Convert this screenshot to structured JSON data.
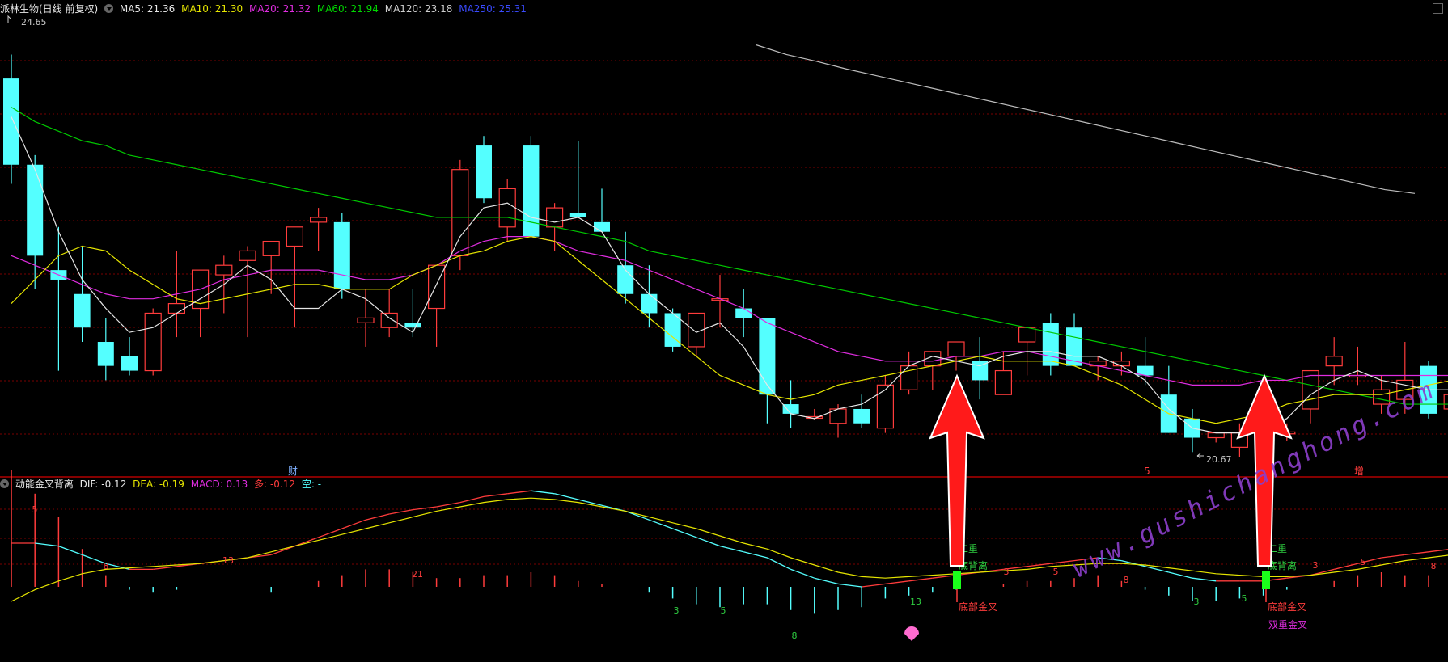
{
  "main_header": {
    "title": "派林生物(日线 前复权)",
    "ma5": "MA5: 21.36",
    "ma10": "MA10: 21.30",
    "ma20": "MA20: 21.32",
    "ma60": "MA60: 21.94",
    "ma120": "MA120: 23.18",
    "ma250": "MA250: 25.31"
  },
  "sub_header": {
    "title": "动能金叉背离",
    "dif": "DIF: -0.12",
    "dea": "DEA: -0.19",
    "macd": "MACD: 0.13",
    "duo": "多: -0.12",
    "kong": "空: -"
  },
  "colors": {
    "up": "#ff3c3c",
    "down": "#54ffff",
    "ma5": "#e6e6e6",
    "ma10": "#e6e600",
    "ma20": "#e02de0",
    "ma60": "#00c800",
    "ma120": "#bdbdbd",
    "ma250": "#2b3cff",
    "arrow": "#ff1a1a",
    "watermark": "#8a3ec8"
  },
  "chart_data": [
    {
      "type": "candlestick",
      "price_range": [
        20.3,
        25.0
      ],
      "high_label": "24.65",
      "low_label": "20.67",
      "candles": [
        [
          24.4,
          24.65,
          23.3,
          23.5
        ],
        [
          23.5,
          23.6,
          22.2,
          22.55
        ],
        [
          22.4,
          22.85,
          21.35,
          22.3
        ],
        [
          22.15,
          22.65,
          21.65,
          21.8
        ],
        [
          21.65,
          21.9,
          21.25,
          21.4
        ],
        [
          21.5,
          21.7,
          21.3,
          21.35
        ],
        [
          21.35,
          22.0,
          21.3,
          21.95
        ],
        [
          21.95,
          22.6,
          21.7,
          22.05
        ],
        [
          22.0,
          22.4,
          21.7,
          22.4
        ],
        [
          22.35,
          22.55,
          21.95,
          22.45
        ],
        [
          22.5,
          22.65,
          21.7,
          22.6
        ],
        [
          22.55,
          22.65,
          22.15,
          22.7
        ],
        [
          22.65,
          22.8,
          21.8,
          22.85
        ],
        [
          22.9,
          23.05,
          22.6,
          22.95
        ],
        [
          22.9,
          23.0,
          22.1,
          22.2
        ],
        [
          21.85,
          22.2,
          21.6,
          21.9
        ],
        [
          21.8,
          22.2,
          21.7,
          21.95
        ],
        [
          21.85,
          22.2,
          21.7,
          21.8
        ],
        [
          22.0,
          22.45,
          21.6,
          22.45
        ],
        [
          22.55,
          23.55,
          22.4,
          23.45
        ],
        [
          23.7,
          23.8,
          23.1,
          23.15
        ],
        [
          22.85,
          23.35,
          22.7,
          23.25
        ],
        [
          23.7,
          23.8,
          22.75,
          22.75
        ],
        [
          22.85,
          23.1,
          22.6,
          23.05
        ],
        [
          23.0,
          23.75,
          22.95,
          22.95
        ],
        [
          22.9,
          23.25,
          22.9,
          22.8
        ],
        [
          22.45,
          22.8,
          22.05,
          22.15
        ],
        [
          22.15,
          22.45,
          21.8,
          21.95
        ],
        [
          21.95,
          22.0,
          21.55,
          21.6
        ],
        [
          21.6,
          21.95,
          21.5,
          21.95
        ],
        [
          22.1,
          22.35,
          21.8,
          22.1
        ],
        [
          22.0,
          22.2,
          21.7,
          21.9
        ],
        [
          21.9,
          21.9,
          20.8,
          21.1
        ],
        [
          21.0,
          21.25,
          20.75,
          20.9
        ],
        [
          20.87,
          20.95,
          20.84,
          20.87
        ],
        [
          20.8,
          21.0,
          20.65,
          20.95
        ],
        [
          20.95,
          21.1,
          20.75,
          20.8
        ],
        [
          20.75,
          21.3,
          20.7,
          21.2
        ],
        [
          21.15,
          21.55,
          21.1,
          21.4
        ],
        [
          21.4,
          21.55,
          21.15,
          21.55
        ],
        [
          21.5,
          21.6,
          21.35,
          21.65
        ],
        [
          21.45,
          21.7,
          21.05,
          21.25
        ],
        [
          21.1,
          21.55,
          21.1,
          21.35
        ],
        [
          21.65,
          21.8,
          21.3,
          21.8
        ],
        [
          21.85,
          21.95,
          21.3,
          21.4
        ],
        [
          21.8,
          21.95,
          21.5,
          21.4
        ],
        [
          21.4,
          21.5,
          21.25,
          21.45
        ],
        [
          21.4,
          21.55,
          21.3,
          21.45
        ],
        [
          21.4,
          21.7,
          21.2,
          21.3
        ],
        [
          21.1,
          21.4,
          20.7,
          20.7
        ],
        [
          20.85,
          20.95,
          20.5,
          20.65
        ],
        [
          20.65,
          20.7,
          20.6,
          20.7
        ],
        [
          20.55,
          20.8,
          20.45,
          20.7
        ],
        [
          20.65,
          20.8,
          20.62,
          20.7
        ],
        [
          20.69,
          20.8,
          20.62,
          20.71
        ],
        [
          20.95,
          21.35,
          20.8,
          21.35
        ],
        [
          21.4,
          21.7,
          21.2,
          21.5
        ],
        [
          21.3,
          21.6,
          21.2,
          21.3
        ],
        [
          21.0,
          21.3,
          20.9,
          21.15
        ],
        [
          21.05,
          21.65,
          20.9,
          21.25
        ],
        [
          21.4,
          21.45,
          20.85,
          20.9
        ],
        [
          20.95,
          21.85,
          20.8,
          21.1
        ],
        [
          21.05,
          21.35,
          20.8,
          21.3
        ]
      ],
      "ma5": [
        24.0,
        23.45,
        22.8,
        22.3,
        22.0,
        21.75,
        21.8,
        21.95,
        22.1,
        22.25,
        22.45,
        22.3,
        22.0,
        22.0,
        22.2,
        22.1,
        21.9,
        21.75,
        22.25,
        22.75,
        23.05,
        23.1,
        22.95,
        22.9,
        22.95,
        22.8,
        22.4,
        22.15,
        21.95,
        21.75,
        21.85,
        21.6,
        21.2,
        20.9,
        20.85,
        20.95,
        21.0,
        21.15,
        21.4,
        21.5,
        21.45,
        21.4,
        21.5,
        21.55,
        21.55,
        21.5,
        21.5,
        21.4,
        21.25,
        20.95,
        20.75,
        20.7,
        20.7,
        20.75,
        20.85,
        21.1,
        21.25,
        21.35,
        21.25,
        21.2,
        21.15,
        21.15,
        21.25
      ],
      "ma10": [
        22.05,
        22.3,
        22.55,
        22.65,
        22.6,
        22.4,
        22.25,
        22.1,
        22.05,
        22.1,
        22.15,
        22.2,
        22.25,
        22.25,
        22.2,
        22.2,
        22.2,
        22.35,
        22.45,
        22.55,
        22.6,
        22.7,
        22.75,
        22.7,
        22.5,
        22.3,
        22.1,
        21.9,
        21.7,
        21.5,
        21.3,
        21.2,
        21.1,
        21.05,
        21.1,
        21.2,
        21.25,
        21.3,
        21.35,
        21.4,
        21.45,
        21.5,
        21.45,
        21.45,
        21.45,
        21.4,
        21.3,
        21.2,
        21.05,
        20.9,
        20.85,
        20.8,
        20.85,
        20.9,
        21.0,
        21.05,
        21.1,
        21.1,
        21.1,
        21.15,
        21.2,
        21.25,
        21.3
      ],
      "ma20": [
        22.55,
        22.45,
        22.35,
        22.25,
        22.15,
        22.1,
        22.1,
        22.15,
        22.2,
        22.3,
        22.35,
        22.4,
        22.4,
        22.4,
        22.35,
        22.3,
        22.3,
        22.35,
        22.45,
        22.6,
        22.7,
        22.75,
        22.75,
        22.7,
        22.6,
        22.55,
        22.5,
        22.4,
        22.3,
        22.2,
        22.1,
        22.0,
        21.85,
        21.75,
        21.65,
        21.55,
        21.5,
        21.45,
        21.45,
        21.45,
        21.5,
        21.5,
        21.55,
        21.55,
        21.5,
        21.45,
        21.4,
        21.35,
        21.3,
        21.25,
        21.2,
        21.2,
        21.2,
        21.25,
        21.25,
        21.3,
        21.3,
        21.3,
        21.3,
        21.3,
        21.3,
        21.3,
        21.32
      ],
      "ma60": [
        24.1,
        23.95,
        23.85,
        23.75,
        23.7,
        23.6,
        23.55,
        23.5,
        23.45,
        23.4,
        23.35,
        23.3,
        23.25,
        23.2,
        23.15,
        23.1,
        23.05,
        23.0,
        22.95,
        22.95,
        22.95,
        22.95,
        22.9,
        22.85,
        22.8,
        22.75,
        22.7,
        22.6,
        22.55,
        22.5,
        22.45,
        22.4,
        22.35,
        22.3,
        22.25,
        22.2,
        22.15,
        22.1,
        22.05,
        22.0,
        21.95,
        21.9,
        21.85,
        21.8,
        21.75,
        21.7,
        21.65,
        21.6,
        21.55,
        21.5,
        21.45,
        21.4,
        21.35,
        21.3,
        21.25,
        21.2,
        21.15,
        21.1,
        21.05,
        21.0,
        21.0,
        21.0,
        21.0
      ],
      "ma120": [
        24.75,
        24.65,
        24.58,
        24.5,
        24.43,
        24.36,
        24.29,
        24.22,
        24.15,
        24.08,
        24.01,
        23.94,
        23.87,
        23.8,
        23.73,
        23.66,
        23.59,
        23.52,
        23.45,
        23.38,
        23.31,
        23.24,
        23.2
      ],
      "markers": [
        "财",
        "5",
        "增"
      ]
    },
    {
      "type": "macd",
      "dif": [
        0.3,
        0.3,
        0.28,
        0.22,
        0.16,
        0.12,
        0.12,
        0.14,
        0.16,
        0.18,
        0.2,
        0.22,
        0.28,
        0.34,
        0.4,
        0.46,
        0.5,
        0.53,
        0.55,
        0.58,
        0.62,
        0.64,
        0.66,
        0.64,
        0.6,
        0.56,
        0.52,
        0.46,
        0.4,
        0.34,
        0.28,
        0.24,
        0.2,
        0.12,
        0.06,
        0.02,
        0.0,
        0.02,
        0.04,
        0.06,
        0.08,
        0.1,
        0.12,
        0.14,
        0.16,
        0.18,
        0.2,
        0.18,
        0.14,
        0.1,
        0.06,
        0.04,
        0.04,
        0.04,
        0.06,
        0.08,
        0.12,
        0.16,
        0.2,
        0.22,
        0.24,
        0.26,
        0.28
      ],
      "dea": [
        -0.1,
        -0.02,
        0.04,
        0.09,
        0.12,
        0.13,
        0.14,
        0.15,
        0.16,
        0.18,
        0.2,
        0.24,
        0.28,
        0.32,
        0.36,
        0.4,
        0.44,
        0.48,
        0.52,
        0.55,
        0.58,
        0.6,
        0.61,
        0.6,
        0.58,
        0.55,
        0.52,
        0.48,
        0.44,
        0.4,
        0.35,
        0.3,
        0.26,
        0.2,
        0.15,
        0.1,
        0.07,
        0.06,
        0.07,
        0.08,
        0.09,
        0.1,
        0.11,
        0.12,
        0.14,
        0.15,
        0.16,
        0.16,
        0.15,
        0.13,
        0.11,
        0.09,
        0.08,
        0.07,
        0.07,
        0.08,
        0.1,
        0.12,
        0.15,
        0.18,
        0.2,
        0.22,
        0.24
      ],
      "number_labels": [
        "5",
        "8",
        "13",
        "21",
        "3",
        "5",
        "8",
        "13",
        "3",
        "5",
        "8",
        "3",
        "5",
        "3",
        "5",
        "8"
      ],
      "signal_labels": {
        "double": "二重",
        "divergence": "底背离",
        "gold_cross": "底部金叉",
        "double_gold": "双重金叉"
      }
    }
  ]
}
